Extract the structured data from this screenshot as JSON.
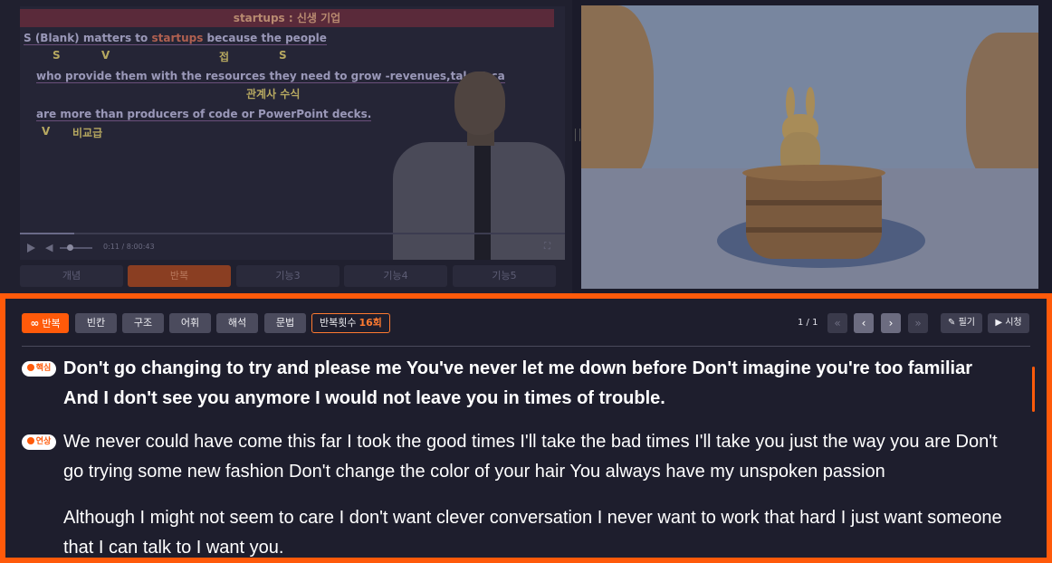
{
  "lecture": {
    "board_title": "startups : 신생 기업",
    "line1": {
      "prefix": "S  (Blank)  matters  to ",
      "highlight": "startups",
      "suffix": "  because  the people"
    },
    "marks1": {
      "s1": "S",
      "v": "V",
      "conj": "접",
      "s2": "S"
    },
    "line2": "who provide them with the resources they need to grow -revenues,talent,ca",
    "mark2": "관계사 수식",
    "line3": "are  more than  producers of code or PowerPoint decks.",
    "marks3": {
      "v": "V",
      "comp": "비교급"
    },
    "time": "0:11 / 8:00:43",
    "tabs": [
      "개념",
      "반복",
      "기능3",
      "기능4",
      "기능5"
    ],
    "active_tab": "반복"
  },
  "toolbar": {
    "modes": [
      "반복",
      "빈칸",
      "구조",
      "어휘",
      "해석",
      "문법"
    ],
    "active_mode": "반복",
    "repeat_label": "반복횟수",
    "repeat_value": "16회",
    "page": "1 / 1",
    "first_icon": "«",
    "prev_icon": "‹",
    "next_icon": "›",
    "last_icon": "»",
    "note_label": "필기",
    "watch_label": "시청"
  },
  "sentences": [
    {
      "badge": "핵심",
      "text": "Don't go changing to try and please me You've never let me down before Don't imagine you're too familiar And I don't see you anymore I would not leave you in times of trouble."
    },
    {
      "badge": "연상",
      "text": "We never could have come this far I took the good times I'll take the bad times I'll take you just the way you are Don't go trying some new fashion Don't change the color of your hair You always have my unspoken passion"
    },
    {
      "badge": "",
      "text": "Although I might not seem to care I don't want clever conversation I never want to work that hard I just want someone that I can talk to I want you."
    }
  ],
  "colors": {
    "accent": "#ff5a0a",
    "panel": "#1e1e2d"
  }
}
